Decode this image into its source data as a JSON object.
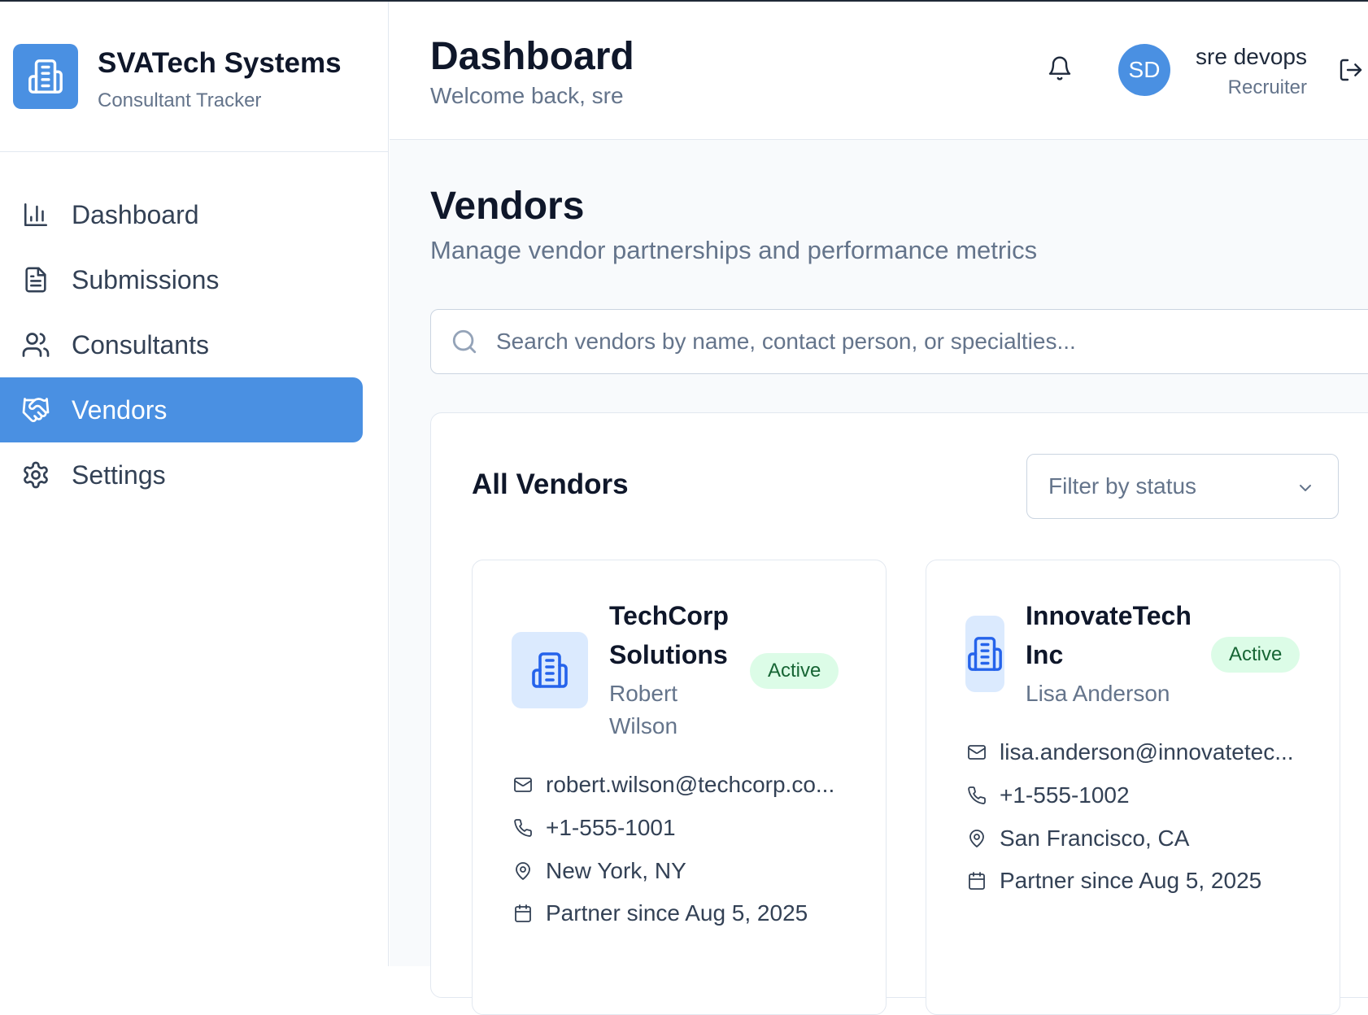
{
  "brand": {
    "name": "SVATech Systems",
    "subtitle": "Consultant Tracker"
  },
  "sidebar": {
    "items": [
      {
        "label": "Dashboard",
        "icon": "bar-chart-icon",
        "active": false
      },
      {
        "label": "Submissions",
        "icon": "document-icon",
        "active": false
      },
      {
        "label": "Consultants",
        "icon": "users-icon",
        "active": false
      },
      {
        "label": "Vendors",
        "icon": "handshake-icon",
        "active": true
      },
      {
        "label": "Settings",
        "icon": "gear-icon",
        "active": false
      }
    ]
  },
  "header": {
    "title": "Dashboard",
    "subtitle": "Welcome back, sre",
    "user": {
      "initials": "SD",
      "name": "sre devops",
      "role": "Recruiter"
    }
  },
  "main": {
    "title": "Vendors",
    "subtitle": "Manage vendor partnerships and performance metrics",
    "search_placeholder": "Search vendors by name, contact person, or specialties...",
    "panel_title": "All Vendors",
    "filter_placeholder": "Filter by status"
  },
  "vendors": [
    {
      "name_line1": "TechCorp",
      "name_line2": "Solutions",
      "contact_line1": "Robert",
      "contact_line2": "Wilson",
      "status": "Active",
      "email": "robert.wilson@techcorp.co...",
      "phone": "+1-555-1001",
      "location": "New York, NY",
      "partner_since": "Partner since Aug 5, 2025"
    },
    {
      "name_line1": "InnovateTech",
      "name_line2": "Inc",
      "contact_line1": "Lisa Anderson",
      "status": "Active",
      "email": "lisa.anderson@innovatetec...",
      "phone": "+1-555-1002",
      "location": "San Francisco, CA",
      "partner_since": "Partner since Aug 5, 2025"
    }
  ],
  "colors": {
    "accent": "#4a90e2",
    "active_badge_bg": "#dcfce7",
    "active_badge_text": "#166534"
  }
}
